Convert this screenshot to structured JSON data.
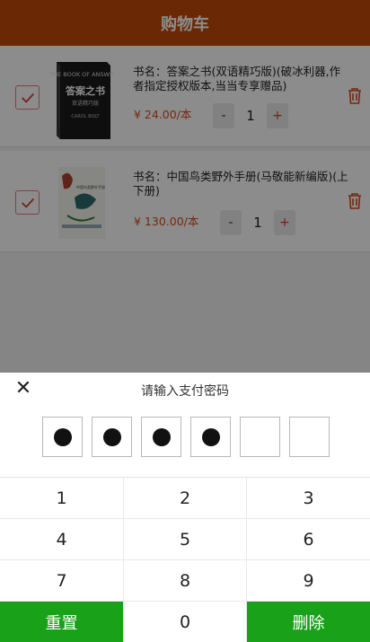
{
  "header": {
    "title": "购物车"
  },
  "cart": {
    "items": [
      {
        "title": "书名：答案之书(双语精巧版)(破冰利器,作者指定授权版本,当当专享赠品)",
        "price": "¥ 24.00/本",
        "qty": "1",
        "minus": "-",
        "plus": "+",
        "cover_title": "THE BOOK OF ANSWERS",
        "cover_cn": "答案之书",
        "cover_sub": "双语精巧版",
        "cover_author": "CAROL BOLT"
      },
      {
        "title": "书名：中国鸟类野外手册(马敬能新编版)(上下册)",
        "price": "¥ 130.00/本",
        "qty": "1",
        "minus": "-",
        "plus": "+",
        "cover_title": "中国鸟类野外手册"
      }
    ]
  },
  "payment": {
    "prompt": "请输入支付密码",
    "close_symbol": "✕",
    "password_slots": [
      true,
      true,
      true,
      true,
      false,
      false
    ],
    "keys": [
      [
        "1",
        "2",
        "3"
      ],
      [
        "4",
        "5",
        "6"
      ],
      [
        "7",
        "8",
        "9"
      ],
      [
        "重置",
        "0",
        "删除"
      ]
    ]
  },
  "colors": {
    "header": "#c34a08",
    "price": "#d94a1a",
    "key_action": "#19a219"
  }
}
